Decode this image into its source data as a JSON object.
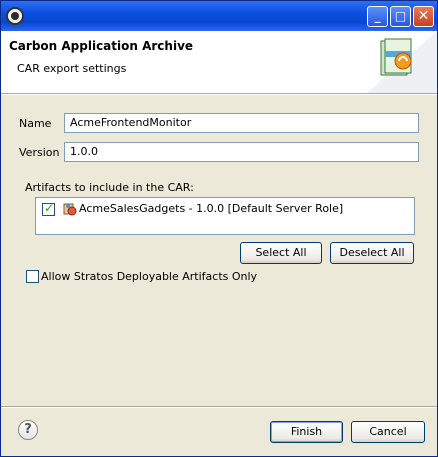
{
  "window": {
    "minimize_glyph": "_",
    "maximize_glyph": "□",
    "close_glyph": "✕"
  },
  "header": {
    "title": "Carbon Application Archive",
    "subtitle": "CAR export settings"
  },
  "form": {
    "name_label": "Name",
    "name_value": "AcmeFrontendMonitor",
    "version_label": "Version",
    "version_value": "1.0.0",
    "artifacts_label": "Artifacts to include in the CAR:",
    "artifacts": [
      {
        "label": "AcmeSalesGadgets - 1.0.0 [Default Server Role]",
        "checked": true
      }
    ],
    "select_all": "Select All",
    "deselect_all": "Deselect All",
    "stratos_label": "Allow Stratos Deployable Artifacts Only",
    "stratos_checked": false
  },
  "footer": {
    "help_glyph": "?",
    "finish": "Finish",
    "cancel": "Cancel"
  },
  "icons": {
    "app": "eclipse-gear-icon",
    "header": "car-archive-icon",
    "artifact": "gadget-artifact-icon",
    "help": "help-icon"
  }
}
